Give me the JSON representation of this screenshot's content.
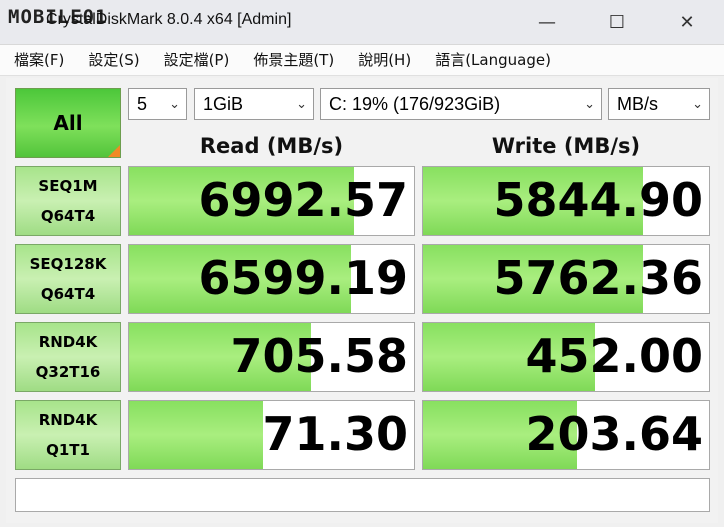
{
  "window": {
    "title": "CrystalDiskMark 8.0.4 x64 [Admin]",
    "watermark": "MOBILE01",
    "minimize": "—",
    "maximize": "☐",
    "close": "✕"
  },
  "menu": [
    "檔案(F)",
    "設定(S)",
    "設定檔(P)",
    "佈景主題(T)",
    "說明(H)",
    "語言(Language)"
  ],
  "controls": {
    "all_label": "All",
    "runs": "5",
    "size": "1GiB",
    "drive": "C: 19% (176/923GiB)",
    "unit": "MB/s"
  },
  "headers": {
    "read": "Read (MB/s)",
    "write": "Write (MB/s)"
  },
  "tests": [
    {
      "line1": "SEQ1M",
      "line2": "Q64T4",
      "read": "6992.57",
      "write": "5844.90",
      "read_fill": 0.79,
      "write_fill": 0.77
    },
    {
      "line1": "SEQ128K",
      "line2": "Q64T4",
      "read": "6599.19",
      "write": "5762.36",
      "read_fill": 0.78,
      "write_fill": 0.77
    },
    {
      "line1": "RND4K",
      "line2": "Q32T16",
      "read": "705.58",
      "write": "452.00",
      "read_fill": 0.64,
      "write_fill": 0.6
    },
    {
      "line1": "RND4K",
      "line2": "Q1T1",
      "read": "71.30",
      "write": "203.64",
      "read_fill": 0.47,
      "write_fill": 0.54
    }
  ],
  "colors": {
    "accent_green": "#7fe05b",
    "corner_orange": "#f08a24"
  }
}
